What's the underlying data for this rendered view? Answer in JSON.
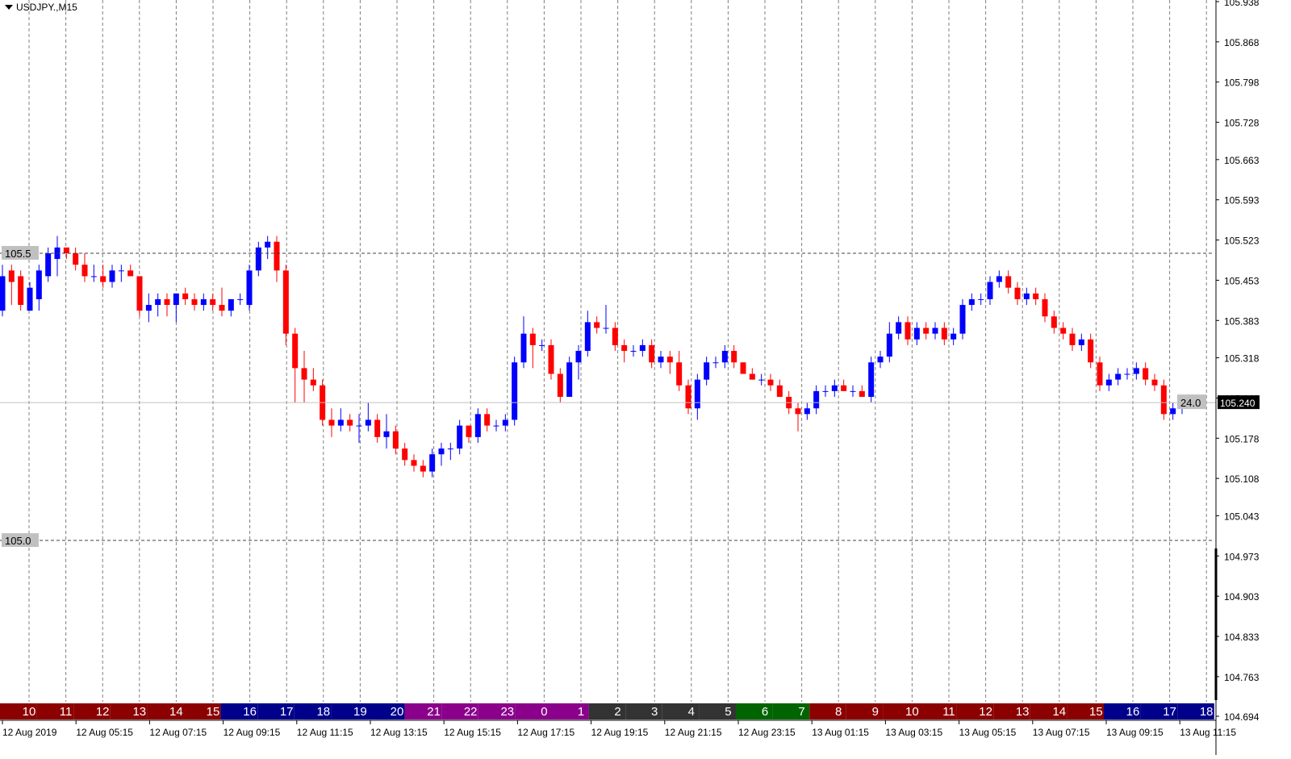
{
  "symbol": {
    "label": "USDJPY.,M15",
    "dropdown_icon": "triangle-down-icon"
  },
  "colors": {
    "bull": "#0000ff",
    "bear": "#ff0000",
    "grid": "#808080",
    "axis": "#000000",
    "current_line": "#c0c0c0",
    "current_tag_bg": "#000000",
    "level_tag_bg": "#c0c0c0",
    "session_dark_red": "#8b0000",
    "session_navy": "#00008b",
    "session_purple": "#8b008b",
    "session_dark_grey": "#333333",
    "session_green": "#006400"
  },
  "chart_data": {
    "type": "candlestick",
    "price_axis_labels": [
      "105.938",
      "105.868",
      "105.798",
      "105.728",
      "105.663",
      "105.593",
      "105.523",
      "105.453",
      "105.383",
      "105.318",
      "105.248",
      "105.178",
      "105.108",
      "105.043",
      "104.973",
      "104.903",
      "104.833",
      "104.763",
      "104.694"
    ],
    "ylim": [
      104.694,
      105.938
    ],
    "time_axis_labels": [
      "12 Aug 2019",
      "12 Aug 05:15",
      "12 Aug 07:15",
      "12 Aug 09:15",
      "12 Aug 11:15",
      "12 Aug 13:15",
      "12 Aug 15:15",
      "12 Aug 17:15",
      "12 Aug 19:15",
      "12 Aug 21:15",
      "12 Aug 23:15",
      "13 Aug 01:15",
      "13 Aug 03:15",
      "13 Aug 05:15",
      "13 Aug 07:15",
      "13 Aug 09:15",
      "13 Aug 11:15"
    ],
    "hour_strip": [
      {
        "label": "10",
        "color": "#8b0000"
      },
      {
        "label": "11",
        "color": "#8b0000"
      },
      {
        "label": "12",
        "color": "#8b0000"
      },
      {
        "label": "13",
        "color": "#8b0000"
      },
      {
        "label": "14",
        "color": "#8b0000"
      },
      {
        "label": "15",
        "color": "#8b0000"
      },
      {
        "label": "16",
        "color": "#00008b"
      },
      {
        "label": "17",
        "color": "#00008b"
      },
      {
        "label": "18",
        "color": "#00008b"
      },
      {
        "label": "19",
        "color": "#00008b"
      },
      {
        "label": "20",
        "color": "#00008b"
      },
      {
        "label": "21",
        "color": "#8b008b"
      },
      {
        "label": "22",
        "color": "#8b008b"
      },
      {
        "label": "23",
        "color": "#8b008b"
      },
      {
        "label": "0",
        "color": "#8b008b"
      },
      {
        "label": "1",
        "color": "#8b008b"
      },
      {
        "label": "2",
        "color": "#333333"
      },
      {
        "label": "3",
        "color": "#333333"
      },
      {
        "label": "4",
        "color": "#333333"
      },
      {
        "label": "5",
        "color": "#333333"
      },
      {
        "label": "6",
        "color": "#006400"
      },
      {
        "label": "7",
        "color": "#006400"
      },
      {
        "label": "8",
        "color": "#8b0000"
      },
      {
        "label": "9",
        "color": "#8b0000"
      },
      {
        "label": "10",
        "color": "#8b0000"
      },
      {
        "label": "11",
        "color": "#8b0000"
      },
      {
        "label": "12",
        "color": "#8b0000"
      },
      {
        "label": "13",
        "color": "#8b0000"
      },
      {
        "label": "14",
        "color": "#8b0000"
      },
      {
        "label": "15",
        "color": "#8b0000"
      },
      {
        "label": "16",
        "color": "#00008b"
      },
      {
        "label": "17",
        "color": "#00008b"
      },
      {
        "label": "18",
        "color": "#00008b"
      }
    ],
    "levels": [
      {
        "label": "105.5",
        "value": 105.5
      },
      {
        "label": "105.0",
        "value": 105.0
      }
    ],
    "current_price": {
      "label": "105.240",
      "value": 105.24
    },
    "spread_label": "24.0",
    "candles": [
      {
        "o": 105.4,
        "h": 105.48,
        "l": 105.39,
        "c": 105.46
      },
      {
        "o": 105.47,
        "h": 105.48,
        "l": 105.41,
        "c": 105.45
      },
      {
        "o": 105.46,
        "h": 105.47,
        "l": 105.4,
        "c": 105.41
      },
      {
        "o": 105.4,
        "h": 105.45,
        "l": 105.4,
        "c": 105.44
      },
      {
        "o": 105.42,
        "h": 105.48,
        "l": 105.4,
        "c": 105.47
      },
      {
        "o": 105.46,
        "h": 105.51,
        "l": 105.45,
        "c": 105.5
      },
      {
        "o": 105.49,
        "h": 105.53,
        "l": 105.46,
        "c": 105.51
      },
      {
        "o": 105.51,
        "h": 105.5,
        "l": 105.49,
        "c": 105.5
      },
      {
        "o": 105.5,
        "h": 105.51,
        "l": 105.47,
        "c": 105.48
      },
      {
        "o": 105.48,
        "h": 105.5,
        "l": 105.45,
        "c": 105.46
      },
      {
        "o": 105.46,
        "h": 105.48,
        "l": 105.45,
        "c": 105.46
      },
      {
        "o": 105.46,
        "h": 105.48,
        "l": 105.44,
        "c": 105.45
      },
      {
        "o": 105.45,
        "h": 105.48,
        "l": 105.44,
        "c": 105.47
      },
      {
        "o": 105.47,
        "h": 105.48,
        "l": 105.45,
        "c": 105.47
      },
      {
        "o": 105.47,
        "h": 105.48,
        "l": 105.46,
        "c": 105.46
      },
      {
        "o": 105.46,
        "h": 105.45,
        "l": 105.39,
        "c": 105.4
      },
      {
        "o": 105.4,
        "h": 105.43,
        "l": 105.38,
        "c": 105.41
      },
      {
        "o": 105.41,
        "h": 105.43,
        "l": 105.39,
        "c": 105.42
      },
      {
        "o": 105.42,
        "h": 105.43,
        "l": 105.39,
        "c": 105.41
      },
      {
        "o": 105.41,
        "h": 105.43,
        "l": 105.38,
        "c": 105.43
      },
      {
        "o": 105.43,
        "h": 105.44,
        "l": 105.41,
        "c": 105.42
      },
      {
        "o": 105.42,
        "h": 105.43,
        "l": 105.4,
        "c": 105.41
      },
      {
        "o": 105.41,
        "h": 105.43,
        "l": 105.4,
        "c": 105.42
      },
      {
        "o": 105.42,
        "h": 105.43,
        "l": 105.4,
        "c": 105.41
      },
      {
        "o": 105.41,
        "h": 105.44,
        "l": 105.39,
        "c": 105.4
      },
      {
        "o": 105.4,
        "h": 105.42,
        "l": 105.39,
        "c": 105.42
      },
      {
        "o": 105.42,
        "h": 105.43,
        "l": 105.41,
        "c": 105.42
      },
      {
        "o": 105.41,
        "h": 105.48,
        "l": 105.4,
        "c": 105.47
      },
      {
        "o": 105.47,
        "h": 105.52,
        "l": 105.46,
        "c": 105.51
      },
      {
        "o": 105.51,
        "h": 105.53,
        "l": 105.49,
        "c": 105.52
      },
      {
        "o": 105.52,
        "h": 105.53,
        "l": 105.45,
        "c": 105.47
      },
      {
        "o": 105.47,
        "h": 105.48,
        "l": 105.34,
        "c": 105.36
      },
      {
        "o": 105.36,
        "h": 105.37,
        "l": 105.24,
        "c": 105.3
      },
      {
        "o": 105.3,
        "h": 105.33,
        "l": 105.24,
        "c": 105.28
      },
      {
        "o": 105.28,
        "h": 105.3,
        "l": 105.26,
        "c": 105.27
      },
      {
        "o": 105.27,
        "h": 105.28,
        "l": 105.2,
        "c": 105.21
      },
      {
        "o": 105.21,
        "h": 105.23,
        "l": 105.18,
        "c": 105.2
      },
      {
        "o": 105.2,
        "h": 105.23,
        "l": 105.19,
        "c": 105.21
      },
      {
        "o": 105.21,
        "h": 105.22,
        "l": 105.19,
        "c": 105.2
      },
      {
        "o": 105.2,
        "h": 105.22,
        "l": 105.17,
        "c": 105.2
      },
      {
        "o": 105.2,
        "h": 105.24,
        "l": 105.19,
        "c": 105.21
      },
      {
        "o": 105.21,
        "h": 105.22,
        "l": 105.17,
        "c": 105.18
      },
      {
        "o": 105.18,
        "h": 105.22,
        "l": 105.16,
        "c": 105.19
      },
      {
        "o": 105.19,
        "h": 105.2,
        "l": 105.15,
        "c": 105.16
      },
      {
        "o": 105.16,
        "h": 105.17,
        "l": 105.13,
        "c": 105.14
      },
      {
        "o": 105.14,
        "h": 105.15,
        "l": 105.12,
        "c": 105.13
      },
      {
        "o": 105.13,
        "h": 105.14,
        "l": 105.11,
        "c": 105.12
      },
      {
        "o": 105.12,
        "h": 105.16,
        "l": 105.11,
        "c": 105.15
      },
      {
        "o": 105.15,
        "h": 105.17,
        "l": 105.13,
        "c": 105.16
      },
      {
        "o": 105.16,
        "h": 105.17,
        "l": 105.14,
        "c": 105.16
      },
      {
        "o": 105.16,
        "h": 105.21,
        "l": 105.15,
        "c": 105.2
      },
      {
        "o": 105.2,
        "h": 105.2,
        "l": 105.17,
        "c": 105.18
      },
      {
        "o": 105.18,
        "h": 105.23,
        "l": 105.17,
        "c": 105.22
      },
      {
        "o": 105.22,
        "h": 105.23,
        "l": 105.19,
        "c": 105.2
      },
      {
        "o": 105.2,
        "h": 105.21,
        "l": 105.19,
        "c": 105.2
      },
      {
        "o": 105.2,
        "h": 105.22,
        "l": 105.19,
        "c": 105.21
      },
      {
        "o": 105.21,
        "h": 105.32,
        "l": 105.2,
        "c": 105.31
      },
      {
        "o": 105.31,
        "h": 105.39,
        "l": 105.3,
        "c": 105.36
      },
      {
        "o": 105.36,
        "h": 105.37,
        "l": 105.3,
        "c": 105.34
      },
      {
        "o": 105.34,
        "h": 105.35,
        "l": 105.33,
        "c": 105.34
      },
      {
        "o": 105.34,
        "h": 105.35,
        "l": 105.28,
        "c": 105.29
      },
      {
        "o": 105.29,
        "h": 105.3,
        "l": 105.24,
        "c": 105.25
      },
      {
        "o": 105.25,
        "h": 105.32,
        "l": 105.25,
        "c": 105.31
      },
      {
        "o": 105.31,
        "h": 105.34,
        "l": 105.28,
        "c": 105.33
      },
      {
        "o": 105.33,
        "h": 105.4,
        "l": 105.32,
        "c": 105.38
      },
      {
        "o": 105.38,
        "h": 105.39,
        "l": 105.36,
        "c": 105.37
      },
      {
        "o": 105.37,
        "h": 105.41,
        "l": 105.36,
        "c": 105.37
      },
      {
        "o": 105.37,
        "h": 105.38,
        "l": 105.33,
        "c": 105.34
      },
      {
        "o": 105.34,
        "h": 105.35,
        "l": 105.31,
        "c": 105.33
      },
      {
        "o": 105.33,
        "h": 105.34,
        "l": 105.32,
        "c": 105.33
      },
      {
        "o": 105.33,
        "h": 105.35,
        "l": 105.32,
        "c": 105.34
      },
      {
        "o": 105.34,
        "h": 105.35,
        "l": 105.3,
        "c": 105.31
      },
      {
        "o": 105.31,
        "h": 105.33,
        "l": 105.3,
        "c": 105.32
      },
      {
        "o": 105.32,
        "h": 105.33,
        "l": 105.29,
        "c": 105.31
      },
      {
        "o": 105.31,
        "h": 105.33,
        "l": 105.26,
        "c": 105.27
      },
      {
        "o": 105.27,
        "h": 105.28,
        "l": 105.22,
        "c": 105.23
      },
      {
        "o": 105.23,
        "h": 105.29,
        "l": 105.21,
        "c": 105.28
      },
      {
        "o": 105.28,
        "h": 105.32,
        "l": 105.27,
        "c": 105.31
      },
      {
        "o": 105.31,
        "h": 105.32,
        "l": 105.3,
        "c": 105.31
      },
      {
        "o": 105.31,
        "h": 105.34,
        "l": 105.3,
        "c": 105.33
      },
      {
        "o": 105.33,
        "h": 105.34,
        "l": 105.3,
        "c": 105.31
      },
      {
        "o": 105.31,
        "h": 105.31,
        "l": 105.29,
        "c": 105.29
      },
      {
        "o": 105.29,
        "h": 105.3,
        "l": 105.28,
        "c": 105.28
      },
      {
        "o": 105.28,
        "h": 105.29,
        "l": 105.27,
        "c": 105.28
      },
      {
        "o": 105.28,
        "h": 105.29,
        "l": 105.26,
        "c": 105.27
      },
      {
        "o": 105.27,
        "h": 105.28,
        "l": 105.25,
        "c": 105.25
      },
      {
        "o": 105.25,
        "h": 105.26,
        "l": 105.22,
        "c": 105.23
      },
      {
        "o": 105.23,
        "h": 105.24,
        "l": 105.19,
        "c": 105.22
      },
      {
        "o": 105.22,
        "h": 105.24,
        "l": 105.21,
        "c": 105.23
      },
      {
        "o": 105.23,
        "h": 105.27,
        "l": 105.22,
        "c": 105.26
      },
      {
        "o": 105.26,
        "h": 105.27,
        "l": 105.25,
        "c": 105.26
      },
      {
        "o": 105.26,
        "h": 105.28,
        "l": 105.25,
        "c": 105.27
      },
      {
        "o": 105.27,
        "h": 105.28,
        "l": 105.26,
        "c": 105.26
      },
      {
        "o": 105.26,
        "h": 105.27,
        "l": 105.25,
        "c": 105.26
      },
      {
        "o": 105.26,
        "h": 105.27,
        "l": 105.25,
        "c": 105.25
      },
      {
        "o": 105.25,
        "h": 105.32,
        "l": 105.24,
        "c": 105.31
      },
      {
        "o": 105.31,
        "h": 105.33,
        "l": 105.3,
        "c": 105.32
      },
      {
        "o": 105.32,
        "h": 105.38,
        "l": 105.31,
        "c": 105.36
      },
      {
        "o": 105.36,
        "h": 105.39,
        "l": 105.35,
        "c": 105.38
      },
      {
        "o": 105.38,
        "h": 105.39,
        "l": 105.34,
        "c": 105.35
      },
      {
        "o": 105.35,
        "h": 105.38,
        "l": 105.34,
        "c": 105.37
      },
      {
        "o": 105.37,
        "h": 105.38,
        "l": 105.35,
        "c": 105.36
      },
      {
        "o": 105.36,
        "h": 105.38,
        "l": 105.35,
        "c": 105.37
      },
      {
        "o": 105.37,
        "h": 105.38,
        "l": 105.34,
        "c": 105.35
      },
      {
        "o": 105.35,
        "h": 105.37,
        "l": 105.34,
        "c": 105.36
      },
      {
        "o": 105.36,
        "h": 105.42,
        "l": 105.35,
        "c": 105.41
      },
      {
        "o": 105.41,
        "h": 105.43,
        "l": 105.4,
        "c": 105.42
      },
      {
        "o": 105.42,
        "h": 105.43,
        "l": 105.41,
        "c": 105.42
      },
      {
        "o": 105.42,
        "h": 105.46,
        "l": 105.41,
        "c": 105.45
      },
      {
        "o": 105.45,
        "h": 105.47,
        "l": 105.44,
        "c": 105.46
      },
      {
        "o": 105.46,
        "h": 105.47,
        "l": 105.43,
        "c": 105.44
      },
      {
        "o": 105.44,
        "h": 105.45,
        "l": 105.41,
        "c": 105.42
      },
      {
        "o": 105.42,
        "h": 105.44,
        "l": 105.41,
        "c": 105.43
      },
      {
        "o": 105.43,
        "h": 105.44,
        "l": 105.41,
        "c": 105.42
      },
      {
        "o": 105.42,
        "h": 105.43,
        "l": 105.38,
        "c": 105.39
      },
      {
        "o": 105.39,
        "h": 105.4,
        "l": 105.36,
        "c": 105.37
      },
      {
        "o": 105.37,
        "h": 105.38,
        "l": 105.35,
        "c": 105.36
      },
      {
        "o": 105.36,
        "h": 105.37,
        "l": 105.33,
        "c": 105.34
      },
      {
        "o": 105.34,
        "h": 105.36,
        "l": 105.33,
        "c": 105.35
      },
      {
        "o": 105.35,
        "h": 105.36,
        "l": 105.3,
        "c": 105.31
      },
      {
        "o": 105.31,
        "h": 105.32,
        "l": 105.26,
        "c": 105.27
      },
      {
        "o": 105.27,
        "h": 105.29,
        "l": 105.26,
        "c": 105.28
      },
      {
        "o": 105.28,
        "h": 105.3,
        "l": 105.27,
        "c": 105.29
      },
      {
        "o": 105.29,
        "h": 105.3,
        "l": 105.28,
        "c": 105.29
      },
      {
        "o": 105.29,
        "h": 105.31,
        "l": 105.28,
        "c": 105.3
      },
      {
        "o": 105.3,
        "h": 105.31,
        "l": 105.27,
        "c": 105.28
      },
      {
        "o": 105.28,
        "h": 105.29,
        "l": 105.26,
        "c": 105.27
      },
      {
        "o": 105.27,
        "h": 105.28,
        "l": 105.21,
        "c": 105.22
      },
      {
        "o": 105.22,
        "h": 105.24,
        "l": 105.21,
        "c": 105.23
      },
      {
        "o": 105.23,
        "h": 105.25,
        "l": 105.22,
        "c": 105.24
      }
    ]
  }
}
